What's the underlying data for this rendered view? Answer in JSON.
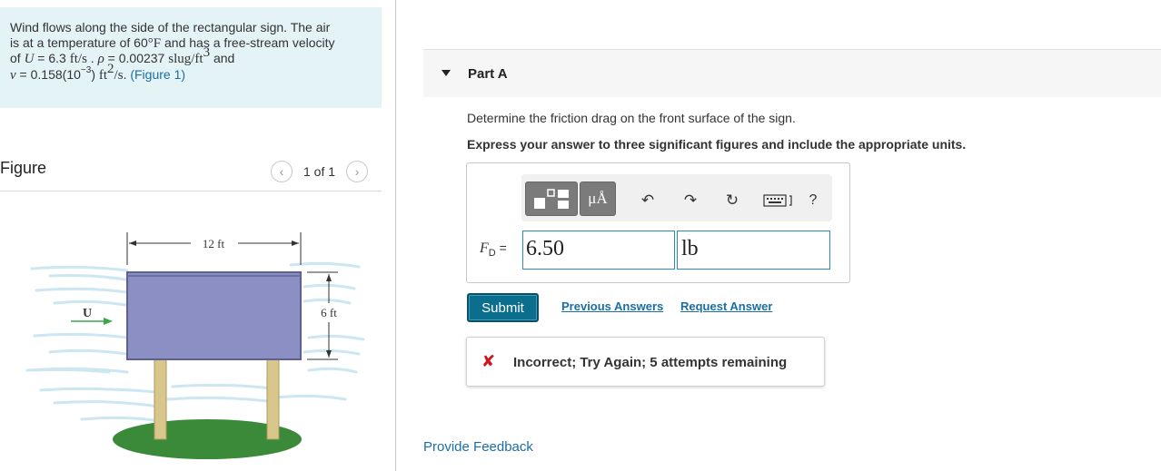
{
  "problem": {
    "line1": "Wind flows along the side of the rectangular sign. The air",
    "line2_pre": "is at a temperature of 60",
    "line2_deg": "°",
    "line2_F": "F",
    "line2_post": " and has a free-stream velocity",
    "line3_of": "of ",
    "line3_U": "U",
    "line3_eq": " = 6.3 ",
    "line3_unit": "ft/s",
    "line3_sep": " . ",
    "line3_rho": "ρ",
    "line3_rhoval": " = 0.00237 ",
    "line3_rhounit": "slug/ft",
    "line3_rhoexp": "3",
    "line3_and": " and",
    "line4_nu": "ν",
    "line4_val": " = 0.158(10",
    "line4_exp": "−3",
    "line4_close": ") ",
    "line4_unit": "ft",
    "line4_unitexp": "2",
    "line4_unit2": "/s",
    "line4_end": ". ",
    "figure_link": "(Figure 1)"
  },
  "figure": {
    "title": "Figure",
    "count": "1 of 1",
    "prev_icon": "chevron-left-icon",
    "next_icon": "chevron-right-icon",
    "labels": {
      "width": "12 ft",
      "height": "6 ft",
      "velocity": "U"
    },
    "colors": {
      "sign": "#8c8fc4",
      "sign_edge": "#5d618f",
      "posts": "#d8c68a",
      "grass": "#3a8a3a",
      "wind": "#bfe0ef",
      "arrow": "#3aa64a"
    }
  },
  "part": {
    "caret_icon": "caret-down-icon",
    "title": "Part A",
    "question": "Determine the friction drag on the front surface of the sign.",
    "instruction": "Express your answer to three significant figures and include the appropriate units."
  },
  "toolbar": {
    "template_icon": "template-icon",
    "units_label": "μÅ",
    "undo_icon": "undo-icon",
    "redo_icon": "redo-icon",
    "reset_icon": "reset-icon",
    "keyboard_icon": "keyboard-icon",
    "help_label": "?"
  },
  "answer": {
    "label_var": "F",
    "label_sub": "D",
    "label_eq": " =",
    "value": "6.50",
    "unit": "lb"
  },
  "actions": {
    "submit": "Submit",
    "previous_answers": "Previous Answers",
    "request_answer": "Request Answer"
  },
  "feedback": {
    "icon": "x-icon",
    "text": "Incorrect; Try Again; 5 attempts remaining",
    "color": "#d0141d"
  },
  "footer": {
    "provide_feedback": "Provide Feedback"
  }
}
